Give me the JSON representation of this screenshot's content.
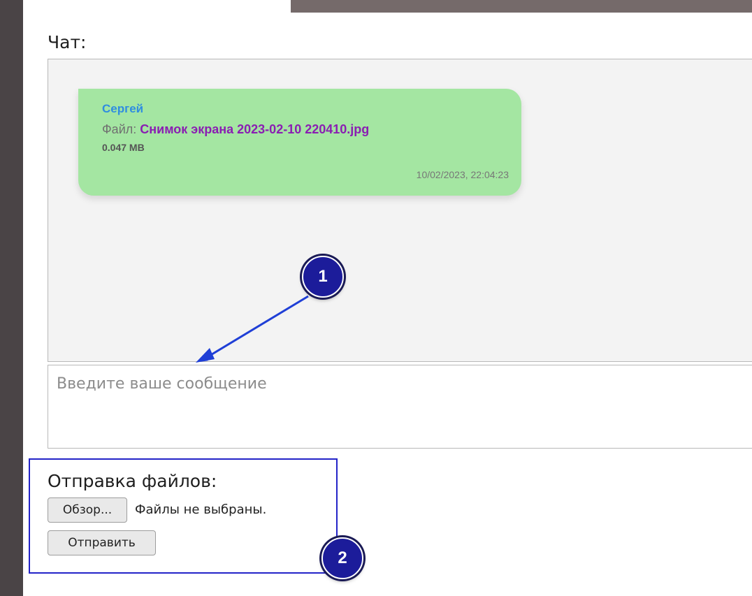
{
  "chat": {
    "label": "Чат:",
    "messages": [
      {
        "sender": "Сергей",
        "file_prefix": "Файл:",
        "file_name": "Снимок экрана 2023-02-10 220410.jpg",
        "file_size": "0.047 MB",
        "timestamp": "10/02/2023, 22:04:23"
      }
    ],
    "input_placeholder": "Введите ваше сообщение"
  },
  "file_upload": {
    "label": "Отправка файлов:",
    "browse_label": "Обзор...",
    "no_files_text": "Файлы не выбраны.",
    "send_label": "Отправить"
  },
  "annotations": {
    "badge_1": "1",
    "badge_2": "2"
  },
  "colors": {
    "message_bubble": "#a4e6a2",
    "sender_name": "#2f8de0",
    "file_name": "#8a1eb2",
    "annotation": "#1c1c9a"
  }
}
